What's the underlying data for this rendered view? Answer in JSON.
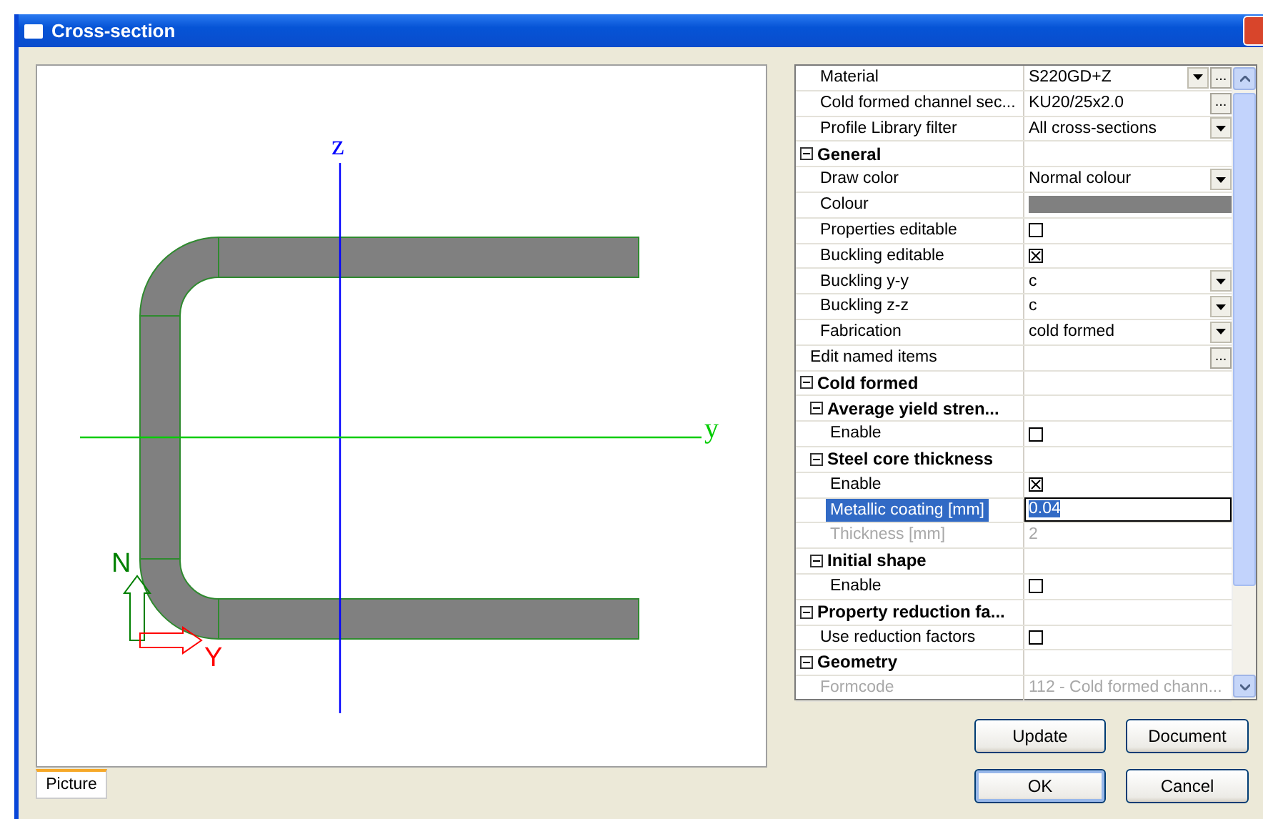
{
  "window": {
    "title": "Cross-section"
  },
  "cross_section": {
    "axes": [
      {
        "kind": "vertical",
        "label": "z",
        "color": "#0000ff"
      },
      {
        "kind": "horizontal",
        "label": "y",
        "color": "#00cc00"
      }
    ],
    "local_axes": [
      {
        "kind": "vertical",
        "label": "N",
        "color": "#008000"
      },
      {
        "kind": "horizontal",
        "label": "Y",
        "color": "#ff0000"
      }
    ]
  },
  "view_tabs": [
    {
      "label": "Picture",
      "selected": true
    }
  ],
  "properties": [
    {
      "kind": "property",
      "label": "Material",
      "value": "S220GD+Z",
      "dropdown": true,
      "browse": "...",
      "selected": false,
      "disabled": false
    },
    {
      "kind": "property",
      "label": "Cold formed channel sec...",
      "value": "KU20/25x2.0",
      "browse": "...",
      "selected": false,
      "disabled": false
    },
    {
      "kind": "property",
      "label": "Profile Library filter",
      "value": "All cross-sections",
      "dropdown": true,
      "selected": false,
      "disabled": false
    },
    {
      "kind": "category",
      "label": "General",
      "expanded": true,
      "children": [
        {
          "kind": "property",
          "label": "Draw color",
          "value": "Normal colour",
          "dropdown": true,
          "selected": false,
          "disabled": false
        },
        {
          "kind": "color",
          "label": "Colour",
          "color": "#808080",
          "selected": false
        },
        {
          "kind": "checkbox",
          "label": "Properties editable",
          "checked": false,
          "selected": false
        },
        {
          "kind": "checkbox",
          "label": "Buckling editable",
          "checked": true,
          "selected": false
        },
        {
          "kind": "property",
          "label": "Buckling y-y",
          "value": "c",
          "dropdown": true,
          "selected": false,
          "disabled": false
        },
        {
          "kind": "property",
          "label": "Buckling z-z",
          "value": "c",
          "dropdown": true,
          "selected": false,
          "disabled": false
        },
        {
          "kind": "property",
          "label": "Fabrication",
          "value": "cold formed",
          "dropdown": true,
          "selected": false,
          "disabled": false
        }
      ]
    },
    {
      "kind": "action",
      "label": "Edit named items",
      "browse": "...",
      "selected": false
    },
    {
      "kind": "category",
      "label": "Cold formed",
      "expanded": true,
      "children": [
        {
          "kind": "category",
          "label": "Average yield stren...",
          "expanded": true,
          "children": [
            {
              "kind": "checkbox",
              "label": "Enable",
              "checked": false,
              "selected": false
            }
          ]
        },
        {
          "kind": "category",
          "label": "Steel core thickness",
          "expanded": true,
          "children": [
            {
              "kind": "checkbox",
              "label": "Enable",
              "checked": true,
              "selected": false
            },
            {
              "kind": "property",
              "label": "Metallic coating [mm]",
              "value": "0.04",
              "selected": true,
              "disabled": false
            },
            {
              "kind": "property",
              "label": "Thickness [mm]",
              "value": "2",
              "selected": false,
              "disabled": true
            }
          ]
        },
        {
          "kind": "category",
          "label": "Initial shape",
          "expanded": true,
          "children": [
            {
              "kind": "checkbox",
              "label": "Enable",
              "checked": false,
              "selected": false
            }
          ]
        }
      ]
    },
    {
      "kind": "category",
      "label": "Property reduction fa...",
      "expanded": true,
      "children": [
        {
          "kind": "checkbox",
          "label": "Use reduction factors",
          "checked": false,
          "selected": false
        }
      ]
    },
    {
      "kind": "category",
      "label": "Geometry",
      "expanded": true,
      "children": [
        {
          "kind": "property",
          "label": "Formcode",
          "value": "112 - Cold formed chann...",
          "selected": false,
          "disabled": true
        }
      ]
    }
  ],
  "buttons": [
    {
      "label": "Update"
    },
    {
      "label": "Document"
    },
    {
      "label": "OK",
      "default": true
    },
    {
      "label": "Cancel"
    }
  ]
}
